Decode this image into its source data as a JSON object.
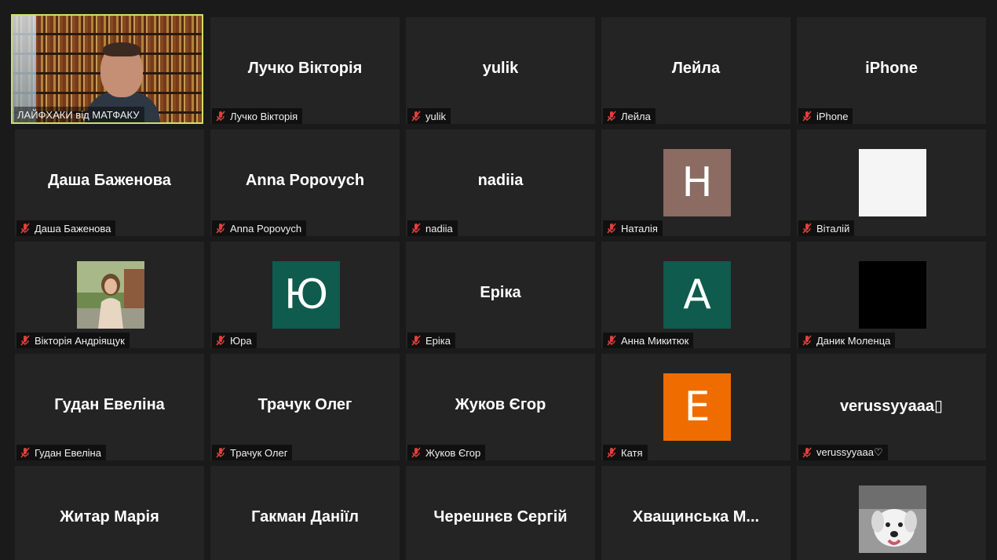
{
  "speaker": {
    "label": "ЛАЙФХАКИ від МАТФАКУ"
  },
  "participants": [
    {
      "big": "Лучко Вікторія",
      "label": "Лучко Вікторія"
    },
    {
      "big": "yulik",
      "label": "yulik"
    },
    {
      "big": "Лейла",
      "label": "Лейла"
    },
    {
      "big": "iPhone",
      "label": "iPhone"
    },
    {
      "big": "Даша Баженова",
      "label": "Даша Баженова"
    },
    {
      "big": "Anna Popovych",
      "label": "Anna Popovych"
    },
    {
      "big": "nadiia",
      "label": "nadiia"
    },
    {
      "avatar_letter": "H",
      "avatar_color": "#8b6b62",
      "label": "Наталія"
    },
    {
      "avatar_color": "#f5f5f5",
      "label": "Віталій"
    },
    {
      "photo": "woman-portrait",
      "label": "Вікторія Андріящук"
    },
    {
      "avatar_letter": "Ю",
      "avatar_color": "#0f5b4d",
      "label": "Юра"
    },
    {
      "big": "Еріка",
      "label": "Еріка"
    },
    {
      "avatar_letter": "A",
      "avatar_color": "#0f5b4d",
      "label": "Анна Микитюк"
    },
    {
      "avatar_color": "#000000",
      "label": "Даник Моленца"
    },
    {
      "big": "Гудан Евеліна",
      "label": "Гудан Евеліна"
    },
    {
      "big": "Трачук Олег",
      "label": "Трачук Олег"
    },
    {
      "big": "Жуков Єгор",
      "label": "Жуков Єгор"
    },
    {
      "avatar_letter": "E",
      "avatar_color": "#ef6c00",
      "label": "Катя"
    },
    {
      "big": "verussyyaaa▯",
      "label": "verussyyaaa♡"
    },
    {
      "big": "Житар Марія"
    },
    {
      "big": "Гакман Даніїл"
    },
    {
      "big": "Черешнєв Сергій"
    },
    {
      "big": "Хващинська  М..."
    },
    {
      "photo": "dog"
    }
  ],
  "icons": {
    "muted": "mic-muted-icon"
  },
  "colors": {
    "background": "#1a1a1a",
    "tile": "#242424",
    "active_speaker_border": "#c9e265",
    "muted_icon": "#e0403a"
  }
}
